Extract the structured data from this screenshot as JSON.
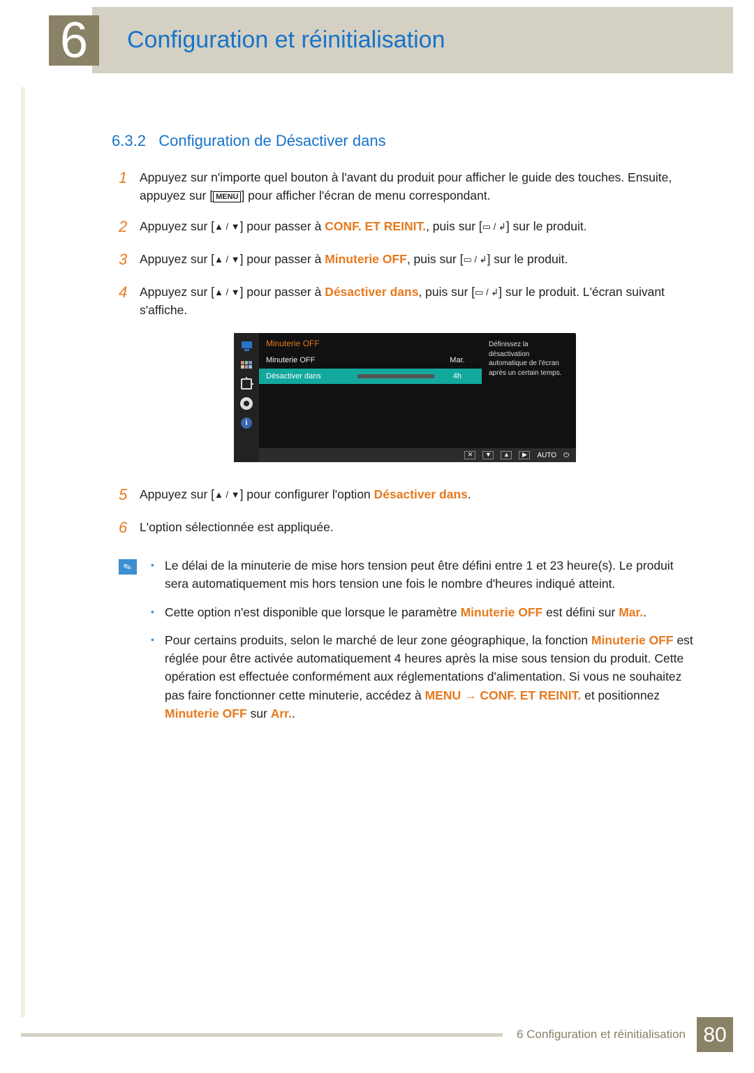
{
  "chapter": {
    "number": "6",
    "title": "Configuration et réinitialisation"
  },
  "section": {
    "number": "6.3.2",
    "title": "Configuration de Désactiver dans"
  },
  "keys": {
    "menu": "MENU",
    "updown": "▲ / ▼",
    "enter": "▭ / ↲"
  },
  "steps": {
    "s1a": "Appuyez sur n'importe quel bouton à l'avant du produit pour afficher le guide des touches. Ensuite, appuyez sur [",
    "s1b": "] pour afficher l'écran de menu correspondant.",
    "s2a": "Appuyez sur [",
    "s2b": "] pour passer à ",
    "s2term": "CONF. ET REINIT.",
    "s2c": ", puis sur [",
    "s2d": "] sur le produit.",
    "s3a": "Appuyez sur [",
    "s3b": "] pour passer à ",
    "s3term": "Minuterie OFF",
    "s3c": ", puis sur [",
    "s3d": "] sur le produit.",
    "s4a": "Appuyez sur [",
    "s4b": "] pour passer à ",
    "s4term": "Désactiver dans",
    "s4c": ", puis sur [",
    "s4d": "] sur le produit. L'écran suivant s'affiche.",
    "s5a": "Appuyez sur [",
    "s5b": "] pour configurer l'option ",
    "s5term": "Désactiver dans",
    "s5c": ".",
    "s6": "L'option sélectionnée est appliquée."
  },
  "osd": {
    "title": "Minuterie OFF",
    "row1": {
      "label": "Minuterie OFF",
      "value": "Mar."
    },
    "row2": {
      "label": "Désactiver dans",
      "value": "4h"
    },
    "help": "Définissez la désactivation automatique de l'écran après un certain temps.",
    "bottom": {
      "close": "✕",
      "down": "▼",
      "up": "▲",
      "right": "▶",
      "auto": "AUTO",
      "power": "⏻"
    }
  },
  "notes": {
    "n1": "Le délai de la minuterie de mise hors tension peut être défini entre 1 et 23 heure(s). Le produit sera automatiquement mis hors tension une fois le nombre d'heures indiqué atteint.",
    "n2a": "Cette option n'est disponible que lorsque le paramètre ",
    "n2term1": "Minuterie OFF",
    "n2b": " est défini sur ",
    "n2term2": "Mar.",
    "n2c": ".",
    "n3a": "Pour certains produits, selon le marché de leur zone géographique, la fonction ",
    "n3term1": "Minuterie OFF",
    "n3b": " est réglée pour être activée automatiquement 4 heures après la mise sous tension du produit. Cette opération est effectuée conformément aux réglementations d'alimentation. Si vous ne souhaitez pas faire fonctionner cette minuterie, accédez à ",
    "n3menu": "MENU",
    "n3arrow": " → ",
    "n3term2": "CONF. ET REINIT.",
    "n3c": " et positionnez ",
    "n3term3": "Minuterie OFF",
    "n3d": " sur ",
    "n3term4": "Arr.",
    "n3e": "."
  },
  "footer": {
    "text": "6 Configuration et réinitialisation",
    "page": "80"
  }
}
